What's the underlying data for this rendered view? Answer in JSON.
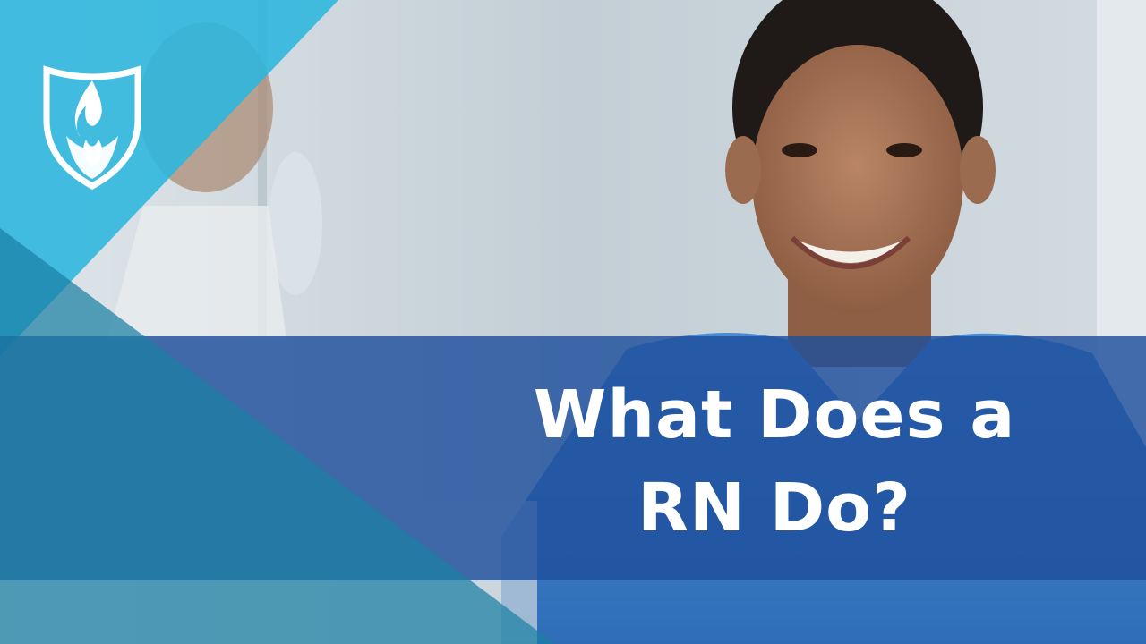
{
  "thumbnail": {
    "title_line_1": "What Does a",
    "title_line_2": "RN Do?",
    "logo_icon": "flame-shield-icon",
    "colors": {
      "band_blue": "#1f4f9c",
      "cyan_triangle": "#2bb6de",
      "teal_triangle": "#1a7fa3",
      "scrubs_blue": "#3d7dc8",
      "text": "#ffffff"
    }
  }
}
